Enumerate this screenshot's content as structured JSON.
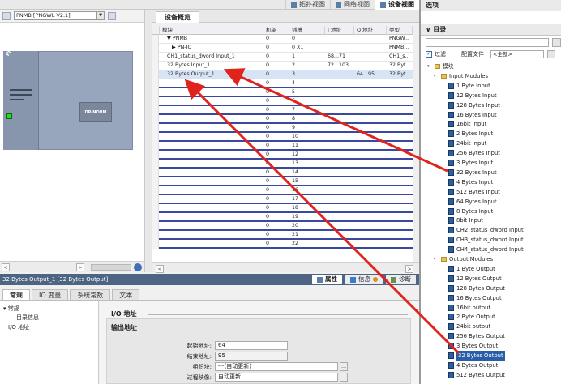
{
  "toolbar": {
    "view_tabs": [
      {
        "label": "拓扑视图",
        "icon": "topology-icon"
      },
      {
        "label": "网络视图",
        "icon": "network-icon"
      },
      {
        "label": "设备视图",
        "icon": "device-icon"
      }
    ]
  },
  "device_view": {
    "device_select": "PNMB [PNGWL V2.1]",
    "rack_label": "PNMB",
    "module_label": "DP-NORM"
  },
  "overview": {
    "tab": "设备概览",
    "columns": [
      "模块",
      "机架",
      "插槽",
      "I 地址",
      "Q 地址",
      "类型"
    ],
    "rows": [
      {
        "module": "PNMB",
        "rack": "0",
        "slot": "0",
        "i": "",
        "q": "",
        "type": "PNGW...",
        "indent": 1,
        "toggle": "▼"
      },
      {
        "module": "PN-IO",
        "rack": "0",
        "slot": "0 X1",
        "i": "",
        "q": "",
        "type": "PNMB...",
        "indent": 2,
        "toggle": "▶"
      },
      {
        "module": "CH1_status_dword Input_1",
        "rack": "0",
        "slot": "1",
        "i": "68...71",
        "q": "",
        "type": "CH1_s...",
        "indent": 1,
        "toggle": ""
      },
      {
        "module": "32 Bytes Input_1",
        "rack": "0",
        "slot": "2",
        "i": "72...103",
        "q": "",
        "type": "32 Byt...",
        "indent": 1,
        "toggle": ""
      },
      {
        "module": "32 Bytes Output_1",
        "rack": "0",
        "slot": "3",
        "i": "",
        "q": "64...95",
        "type": "32 Byt...",
        "indent": 1,
        "toggle": "",
        "selected": true
      }
    ],
    "empty_slots": [
      "4",
      "5",
      "6",
      "7",
      "8",
      "9",
      "10",
      "11",
      "12",
      "13",
      "14",
      "15",
      "16",
      "17",
      "18",
      "19",
      "20",
      "21",
      "22"
    ],
    "empty_rack": "0"
  },
  "properties": {
    "title": "32 Bytes Output_1 [32 Bytes Output]",
    "right_tabs": [
      "属性",
      "信息",
      "诊断"
    ],
    "tabs": [
      "常规",
      "IO 变量",
      "系统常数",
      "文本"
    ],
    "nav": [
      "常规",
      "目录信息",
      "I/O 地址"
    ],
    "section": "I/O 地址",
    "subsection": "输出地址",
    "fields": [
      {
        "label": "起始地址:",
        "value": "64"
      },
      {
        "label": "结束地址:",
        "value": "95"
      },
      {
        "label": "组织块:",
        "value": "---(自动更新)"
      },
      {
        "label": "过程映像:",
        "value": "自动更新"
      }
    ]
  },
  "catalog": {
    "options_title": "选项",
    "catalog_title": "目录",
    "filter_label": "过滤",
    "profile_label": "配置文件",
    "profile_value": "<全部>",
    "root": "模块",
    "input_group": "Input Modules",
    "input_items": [
      "1 Byte Input",
      "12 Bytes Input",
      "128 Bytes Input",
      "16 Bytes Input",
      "16bit Input",
      "2 Bytes Input",
      "24bit Input",
      "256 Bytes Input",
      "3 Bytes Input",
      "32 Bytes Input",
      "4 Bytes Input",
      "512 Bytes Input",
      "64 Bytes Input",
      "8 Bytes Input",
      "8bit Input",
      "CH2_status_dword Input",
      "CH3_status_dword Input",
      "CH4_status_dword Input"
    ],
    "output_group": "Output Modules",
    "output_items": [
      "1 Byte Output",
      "12 Bytes Output",
      "128 Bytes Output",
      "16 Bytes Output",
      "16bit output",
      "2 Byte Output",
      "24bit output",
      "256 Bytes Output",
      "3 Bytes Output",
      "32 Bytes Output",
      "4 Bytes Output",
      "512 Bytes Output"
    ],
    "highlighted": "32 Bytes Output"
  },
  "colors": {
    "accent": "#4d6483",
    "arrow": "#e0241b",
    "selection": "#2a5ea8"
  }
}
